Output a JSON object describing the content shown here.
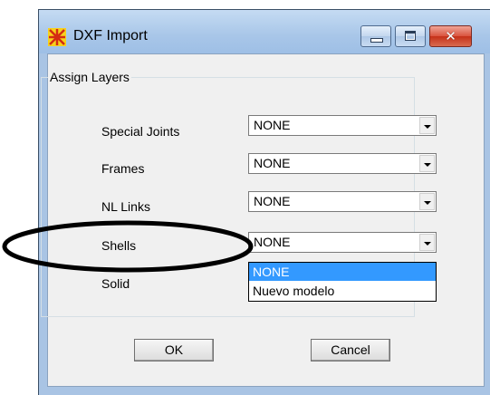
{
  "window": {
    "title": "DXF Import",
    "close_glyph": "✕"
  },
  "group": {
    "label": "Assign Layers"
  },
  "rows": [
    {
      "label": "Special Joints",
      "value": "NONE"
    },
    {
      "label": "Frames",
      "value": "NONE"
    },
    {
      "label": "NL Links",
      "value": "NONE"
    },
    {
      "label": "Shells",
      "value": "NONE"
    },
    {
      "label": "Solid"
    }
  ],
  "dropdown": {
    "options": [
      "NONE",
      "Nuevo modelo"
    ],
    "selected_index": 0
  },
  "buttons": {
    "ok": "OK",
    "cancel": "Cancel"
  },
  "icons": {
    "app": "sap-logo-icon",
    "minimize": "minimize-icon",
    "maximize": "maximize-icon",
    "close": "close-icon"
  },
  "colors": {
    "selection": "#3399ff",
    "close_button": "#c53119",
    "annotation": "#000000"
  }
}
